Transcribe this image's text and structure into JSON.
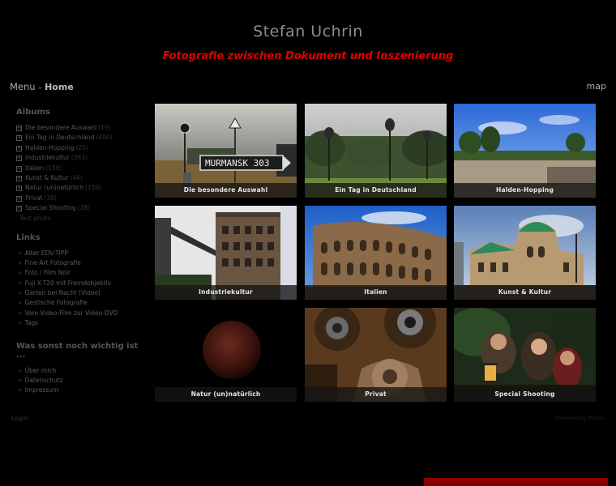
{
  "site": {
    "title": "Stefan Uchrin",
    "subtitle": "Fotografie zwischen Dokument und Inszenierung"
  },
  "nav": {
    "menu_label": "Menu",
    "separator": "»",
    "home_label": "Home",
    "map_label": "map"
  },
  "sidebar": {
    "albums_heading": "Albums",
    "albums": [
      {
        "label": "Die besondere Auswahl",
        "count": "(19)"
      },
      {
        "label": "Ein Tag in Deutschland",
        "count": "(400)"
      },
      {
        "label": "Halden-Hopping",
        "count": "(25)"
      },
      {
        "label": "Industriekultur",
        "count": "(383)"
      },
      {
        "label": "Italien",
        "count": "(150)"
      },
      {
        "label": "Kunst & Kultur",
        "count": "(46)"
      },
      {
        "label": "Natur (un)natürlich",
        "count": "(150)"
      },
      {
        "label": "Privat",
        "count": "(30)"
      },
      {
        "label": "Special Shooting",
        "count": "(28)"
      }
    ],
    "test_photo": "Test photo",
    "links_heading": "Links",
    "links": [
      "Alter EDV-TIPP",
      "Fine-Art Fotografie",
      "Foto / Film Noir",
      "Fuji X-T20 mit Fremdobjektiv",
      "Garten bei Nacht (Video)",
      "Gestische Fotografie",
      "Vom Video-Film zur Video-DVD",
      "Tags"
    ],
    "wichtig_heading": "Was sonst noch wichtig ist ...",
    "wichtig_links": [
      "Über mich",
      "Datenschutz",
      "Impressum"
    ]
  },
  "gallery": {
    "tiles": [
      {
        "caption": "Die besondere Auswahl",
        "sign_text": "MURMANSK 303"
      },
      {
        "caption": "Ein Tag in Deutschland"
      },
      {
        "caption": "Halden-Hopping"
      },
      {
        "caption": "Industriekultur"
      },
      {
        "caption": "Italien"
      },
      {
        "caption": "Kunst & Kultur"
      },
      {
        "caption": "Natur (un)natürlich"
      },
      {
        "caption": "Privat"
      },
      {
        "caption": "Special Shooting"
      }
    ]
  },
  "footer": {
    "login": "Login",
    "powered": "Powered by Piwigo"
  },
  "colors": {
    "background": "#000000",
    "subtitle_red": "#e00000",
    "bottom_bar": "#8a0000"
  }
}
